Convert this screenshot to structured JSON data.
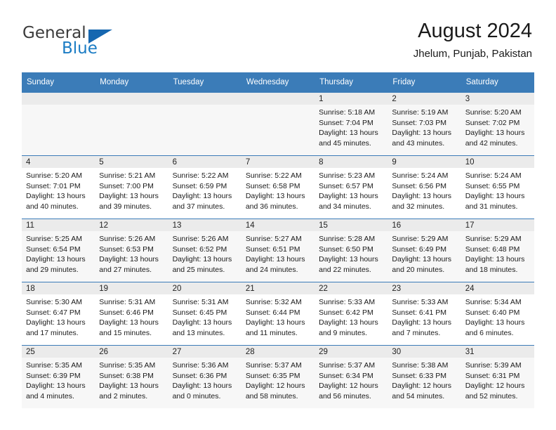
{
  "brand": {
    "name_part1": "General",
    "name_part2": "Blue",
    "logo_icon": "triangle-flag-icon",
    "color_primary": "#1667b0",
    "color_text": "#3b3b3b"
  },
  "header": {
    "title": "August 2024",
    "location": "Jhelum, Punjab, Pakistan"
  },
  "theme": {
    "header_row_bg": "#3b7cb8",
    "day_band_bg": "#ebebeb",
    "row_shaded_bg": "#f7f7f7",
    "grid_line": "#3b7cb8"
  },
  "weekday_headers": [
    "Sunday",
    "Monday",
    "Tuesday",
    "Wednesday",
    "Thursday",
    "Friday",
    "Saturday"
  ],
  "weeks": [
    [
      {
        "day": "",
        "sunrise": "",
        "sunset": "",
        "daylight_line1": "",
        "daylight_line2": "",
        "empty": true
      },
      {
        "day": "",
        "sunrise": "",
        "sunset": "",
        "daylight_line1": "",
        "daylight_line2": "",
        "empty": true
      },
      {
        "day": "",
        "sunrise": "",
        "sunset": "",
        "daylight_line1": "",
        "daylight_line2": "",
        "empty": true
      },
      {
        "day": "",
        "sunrise": "",
        "sunset": "",
        "daylight_line1": "",
        "daylight_line2": "",
        "empty": true
      },
      {
        "day": "1",
        "sunrise": "Sunrise: 5:18 AM",
        "sunset": "Sunset: 7:04 PM",
        "daylight_line1": "Daylight: 13 hours",
        "daylight_line2": "and 45 minutes."
      },
      {
        "day": "2",
        "sunrise": "Sunrise: 5:19 AM",
        "sunset": "Sunset: 7:03 PM",
        "daylight_line1": "Daylight: 13 hours",
        "daylight_line2": "and 43 minutes."
      },
      {
        "day": "3",
        "sunrise": "Sunrise: 5:20 AM",
        "sunset": "Sunset: 7:02 PM",
        "daylight_line1": "Daylight: 13 hours",
        "daylight_line2": "and 42 minutes."
      }
    ],
    [
      {
        "day": "4",
        "sunrise": "Sunrise: 5:20 AM",
        "sunset": "Sunset: 7:01 PM",
        "daylight_line1": "Daylight: 13 hours",
        "daylight_line2": "and 40 minutes."
      },
      {
        "day": "5",
        "sunrise": "Sunrise: 5:21 AM",
        "sunset": "Sunset: 7:00 PM",
        "daylight_line1": "Daylight: 13 hours",
        "daylight_line2": "and 39 minutes."
      },
      {
        "day": "6",
        "sunrise": "Sunrise: 5:22 AM",
        "sunset": "Sunset: 6:59 PM",
        "daylight_line1": "Daylight: 13 hours",
        "daylight_line2": "and 37 minutes."
      },
      {
        "day": "7",
        "sunrise": "Sunrise: 5:22 AM",
        "sunset": "Sunset: 6:58 PM",
        "daylight_line1": "Daylight: 13 hours",
        "daylight_line2": "and 36 minutes."
      },
      {
        "day": "8",
        "sunrise": "Sunrise: 5:23 AM",
        "sunset": "Sunset: 6:57 PM",
        "daylight_line1": "Daylight: 13 hours",
        "daylight_line2": "and 34 minutes."
      },
      {
        "day": "9",
        "sunrise": "Sunrise: 5:24 AM",
        "sunset": "Sunset: 6:56 PM",
        "daylight_line1": "Daylight: 13 hours",
        "daylight_line2": "and 32 minutes."
      },
      {
        "day": "10",
        "sunrise": "Sunrise: 5:24 AM",
        "sunset": "Sunset: 6:55 PM",
        "daylight_line1": "Daylight: 13 hours",
        "daylight_line2": "and 31 minutes."
      }
    ],
    [
      {
        "day": "11",
        "sunrise": "Sunrise: 5:25 AM",
        "sunset": "Sunset: 6:54 PM",
        "daylight_line1": "Daylight: 13 hours",
        "daylight_line2": "and 29 minutes."
      },
      {
        "day": "12",
        "sunrise": "Sunrise: 5:26 AM",
        "sunset": "Sunset: 6:53 PM",
        "daylight_line1": "Daylight: 13 hours",
        "daylight_line2": "and 27 minutes."
      },
      {
        "day": "13",
        "sunrise": "Sunrise: 5:26 AM",
        "sunset": "Sunset: 6:52 PM",
        "daylight_line1": "Daylight: 13 hours",
        "daylight_line2": "and 25 minutes."
      },
      {
        "day": "14",
        "sunrise": "Sunrise: 5:27 AM",
        "sunset": "Sunset: 6:51 PM",
        "daylight_line1": "Daylight: 13 hours",
        "daylight_line2": "and 24 minutes."
      },
      {
        "day": "15",
        "sunrise": "Sunrise: 5:28 AM",
        "sunset": "Sunset: 6:50 PM",
        "daylight_line1": "Daylight: 13 hours",
        "daylight_line2": "and 22 minutes."
      },
      {
        "day": "16",
        "sunrise": "Sunrise: 5:29 AM",
        "sunset": "Sunset: 6:49 PM",
        "daylight_line1": "Daylight: 13 hours",
        "daylight_line2": "and 20 minutes."
      },
      {
        "day": "17",
        "sunrise": "Sunrise: 5:29 AM",
        "sunset": "Sunset: 6:48 PM",
        "daylight_line1": "Daylight: 13 hours",
        "daylight_line2": "and 18 minutes."
      }
    ],
    [
      {
        "day": "18",
        "sunrise": "Sunrise: 5:30 AM",
        "sunset": "Sunset: 6:47 PM",
        "daylight_line1": "Daylight: 13 hours",
        "daylight_line2": "and 17 minutes."
      },
      {
        "day": "19",
        "sunrise": "Sunrise: 5:31 AM",
        "sunset": "Sunset: 6:46 PM",
        "daylight_line1": "Daylight: 13 hours",
        "daylight_line2": "and 15 minutes."
      },
      {
        "day": "20",
        "sunrise": "Sunrise: 5:31 AM",
        "sunset": "Sunset: 6:45 PM",
        "daylight_line1": "Daylight: 13 hours",
        "daylight_line2": "and 13 minutes."
      },
      {
        "day": "21",
        "sunrise": "Sunrise: 5:32 AM",
        "sunset": "Sunset: 6:44 PM",
        "daylight_line1": "Daylight: 13 hours",
        "daylight_line2": "and 11 minutes."
      },
      {
        "day": "22",
        "sunrise": "Sunrise: 5:33 AM",
        "sunset": "Sunset: 6:42 PM",
        "daylight_line1": "Daylight: 13 hours",
        "daylight_line2": "and 9 minutes."
      },
      {
        "day": "23",
        "sunrise": "Sunrise: 5:33 AM",
        "sunset": "Sunset: 6:41 PM",
        "daylight_line1": "Daylight: 13 hours",
        "daylight_line2": "and 7 minutes."
      },
      {
        "day": "24",
        "sunrise": "Sunrise: 5:34 AM",
        "sunset": "Sunset: 6:40 PM",
        "daylight_line1": "Daylight: 13 hours",
        "daylight_line2": "and 6 minutes."
      }
    ],
    [
      {
        "day": "25",
        "sunrise": "Sunrise: 5:35 AM",
        "sunset": "Sunset: 6:39 PM",
        "daylight_line1": "Daylight: 13 hours",
        "daylight_line2": "and 4 minutes."
      },
      {
        "day": "26",
        "sunrise": "Sunrise: 5:35 AM",
        "sunset": "Sunset: 6:38 PM",
        "daylight_line1": "Daylight: 13 hours",
        "daylight_line2": "and 2 minutes."
      },
      {
        "day": "27",
        "sunrise": "Sunrise: 5:36 AM",
        "sunset": "Sunset: 6:36 PM",
        "daylight_line1": "Daylight: 13 hours",
        "daylight_line2": "and 0 minutes."
      },
      {
        "day": "28",
        "sunrise": "Sunrise: 5:37 AM",
        "sunset": "Sunset: 6:35 PM",
        "daylight_line1": "Daylight: 12 hours",
        "daylight_line2": "and 58 minutes."
      },
      {
        "day": "29",
        "sunrise": "Sunrise: 5:37 AM",
        "sunset": "Sunset: 6:34 PM",
        "daylight_line1": "Daylight: 12 hours",
        "daylight_line2": "and 56 minutes."
      },
      {
        "day": "30",
        "sunrise": "Sunrise: 5:38 AM",
        "sunset": "Sunset: 6:33 PM",
        "daylight_line1": "Daylight: 12 hours",
        "daylight_line2": "and 54 minutes."
      },
      {
        "day": "31",
        "sunrise": "Sunrise: 5:39 AM",
        "sunset": "Sunset: 6:31 PM",
        "daylight_line1": "Daylight: 12 hours",
        "daylight_line2": "and 52 minutes."
      }
    ]
  ]
}
